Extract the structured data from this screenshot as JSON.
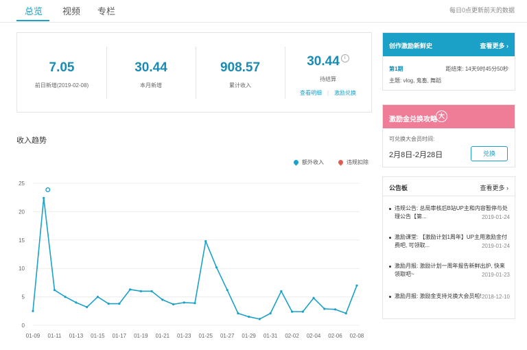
{
  "tabs": [
    "总览",
    "视频",
    "专栏"
  ],
  "tab_note": "每日0点更新前天的数据",
  "stats": [
    {
      "value": "7.05",
      "label": "前日新增(2019-02-08)"
    },
    {
      "value": "30.44",
      "label": "本月新增"
    },
    {
      "value": "908.57",
      "label": "累计收入"
    },
    {
      "value": "30.44",
      "label": "待结算"
    }
  ],
  "links": {
    "view_details": "查看明细",
    "incentive_exchange": "激励兑换"
  },
  "income": {
    "title": "收入趋势",
    "legend": {
      "extra_income": "额外收入",
      "violation_deduction": "违规扣除"
    }
  },
  "chart_data": {
    "type": "line",
    "title": "收入趋势",
    "xlabel": "",
    "ylabel": "",
    "x": [
      "01-09",
      "01-10",
      "01-11",
      "01-12",
      "01-13",
      "01-14",
      "01-15",
      "01-16",
      "01-17",
      "01-18",
      "01-19",
      "01-20",
      "01-21",
      "01-22",
      "01-23",
      "01-24",
      "01-25",
      "01-26",
      "01-27",
      "01-28",
      "01-29",
      "01-30",
      "01-31",
      "02-01",
      "02-02",
      "02-03",
      "02-04",
      "02-05",
      "02-06",
      "02-07",
      "02-08"
    ],
    "xticks": [
      "01-09",
      "01-11",
      "01-13",
      "01-15",
      "01-17",
      "01-19",
      "01-21",
      "01-23",
      "01-25",
      "01-27",
      "01-29",
      "01-31",
      "02-02",
      "02-04",
      "02-06",
      "02-08"
    ],
    "values": [
      2.5,
      22.4,
      6.2,
      5.0,
      4.0,
      3.2,
      5.0,
      3.8,
      3.8,
      6.3,
      6.0,
      6.0,
      4.5,
      3.7,
      4.0,
      3.9,
      14.8,
      10.2,
      6.2,
      2.1,
      1.5,
      1.1,
      2.1,
      6.0,
      2.4,
      2.4,
      4.8,
      2.9,
      2.8,
      2.1,
      7.0
    ],
    "ylim": [
      0,
      25
    ],
    "yticks": [
      0,
      5,
      10,
      15,
      20,
      25
    ],
    "grid": true,
    "legend_position": "top-right",
    "series_color": "#1ba0c8",
    "markers": [
      {
        "x": "01-10",
        "series": "额外收入"
      }
    ]
  },
  "creator_panel": {
    "title": "创作激励新鲜史",
    "more": "查看更多",
    "period": "第1期",
    "countdown": "距结束: 14天9时45分50秒",
    "topic": "主题: vlog, 鬼畜, 舞蹈"
  },
  "exchange_panel": {
    "title": "激励金兑换攻略",
    "badge": "大",
    "subtitle": "可兑换大会员时间:",
    "date_range": "2月8日-2月28日",
    "button": "兑换"
  },
  "notice_panel": {
    "title": "公告板",
    "more": "查看更多",
    "items": [
      {
        "text": "违规公告: 总局审核后B站UP主和内容暂停与处理公告【第...",
        "date": "2019-01-24"
      },
      {
        "text": "激励课堂: 【激励计划1周年】UP主用激励金付费吧, 可领取...",
        "date": "2019-01-24"
      },
      {
        "text": "激励月报: 激励计划一周年报告新鲜出炉, 快来领取吧~",
        "date": "2019-01-23"
      },
      {
        "text": "激励月报: 激励金支持兑换大会员啦!",
        "date": "2018-12-10"
      }
    ]
  },
  "colors": {
    "accent": "#1ba0c8",
    "pink": "#f07d98",
    "violation": "#e05c4f"
  }
}
